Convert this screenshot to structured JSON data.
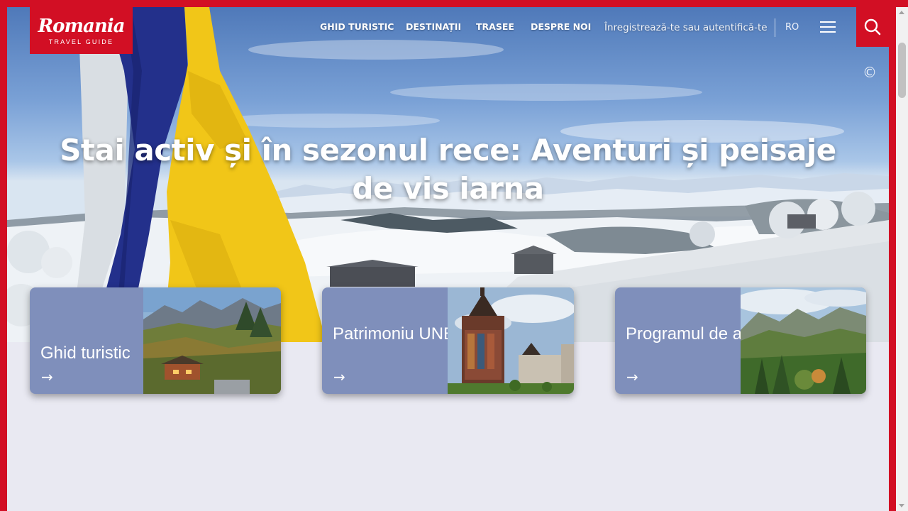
{
  "brand": {
    "logo_script": "Romania",
    "logo_sub": "TRAVEL GUIDE",
    "accent": "#d20f24"
  },
  "nav": {
    "items": [
      {
        "label": "GHID TURISTIC"
      },
      {
        "label": "DESTINAȚII"
      },
      {
        "label": "TRASEE"
      },
      {
        "label": "DESPRE NOI"
      }
    ],
    "auth_label": "Înregistrează-te sau autentifică-te",
    "lang": "RO",
    "menu_icon": "hamburger-icon",
    "search_icon": "search-icon"
  },
  "hero": {
    "title": "Stai activ și în sezonul rece: Aventuri și peisaje de vis iarna",
    "copyright": "©"
  },
  "cards": [
    {
      "label": "Ghid turistic",
      "arrow": "→",
      "color": "#7f8fbb"
    },
    {
      "label": "Patrimoniu UNESCO",
      "arrow": "→",
      "color": "#7f8fbb"
    },
    {
      "label": "Programul de afiliere",
      "arrow": "→",
      "color": "#7f8fbb"
    }
  ],
  "colors": {
    "page_bg": "#e9e9f2",
    "card_bg": "#7f8fbb"
  }
}
